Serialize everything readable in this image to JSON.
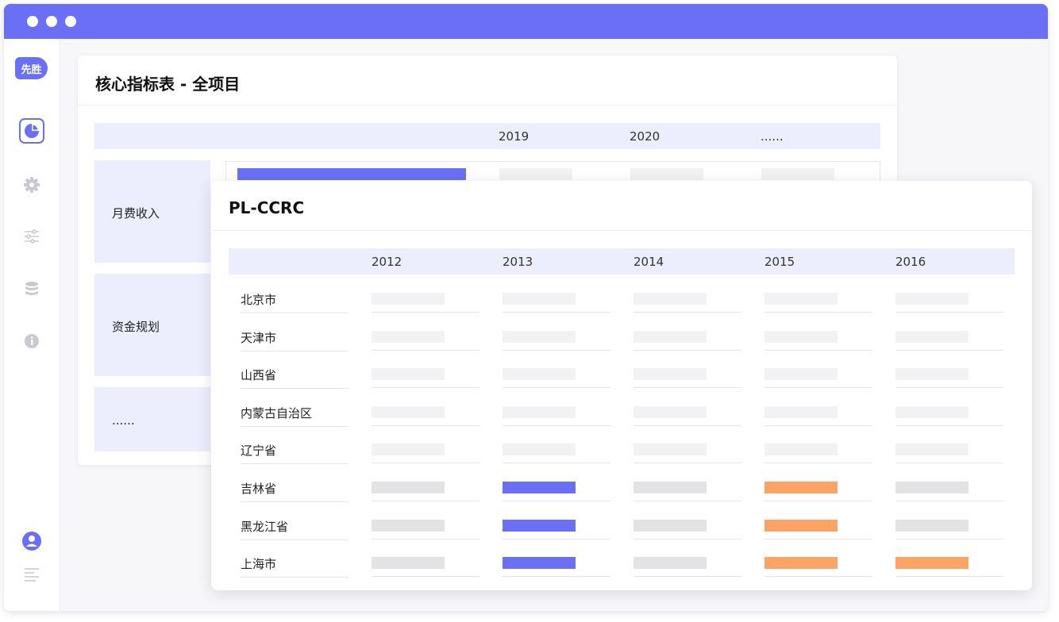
{
  "window": {
    "accent": "#6b6ff6"
  },
  "sidebar": {
    "logo_text": "先胜",
    "icons": [
      "pie-chart-icon",
      "gear-icon",
      "sliders-icon",
      "database-icon",
      "info-icon",
      "user-icon",
      "list-icon"
    ]
  },
  "back_card": {
    "title": "核心指标表 - 全项目",
    "years": [
      "2019",
      "2020",
      "......"
    ],
    "rows": [
      {
        "label": "月费收入"
      },
      {
        "label": "资金规划"
      },
      {
        "label": "......"
      }
    ]
  },
  "front_card": {
    "title": "PL-CCRC",
    "years": [
      "2012",
      "2013",
      "2014",
      "2015",
      "2016"
    ],
    "rows": [
      {
        "label": "北京市",
        "cells": [
          "light",
          "light",
          "light",
          "light",
          "light"
        ]
      },
      {
        "label": "天津市",
        "cells": [
          "light",
          "light",
          "light",
          "light",
          "light"
        ]
      },
      {
        "label": "山西省",
        "cells": [
          "light",
          "light",
          "light",
          "light",
          "light"
        ]
      },
      {
        "label": "内蒙古自治区",
        "cells": [
          "light",
          "light",
          "light",
          "light",
          "light"
        ]
      },
      {
        "label": "辽宁省",
        "cells": [
          "light",
          "light",
          "light",
          "light",
          "light"
        ]
      },
      {
        "label": "吉林省",
        "cells": [
          "gray",
          "blue",
          "gray",
          "orange",
          "gray"
        ]
      },
      {
        "label": "黑龙江省",
        "cells": [
          "gray",
          "blue",
          "gray",
          "orange",
          "gray"
        ]
      },
      {
        "label": "上海市",
        "cells": [
          "gray",
          "blue",
          "gray",
          "orange",
          "orange"
        ]
      }
    ]
  },
  "colors": {
    "blue": "#6b6ff6",
    "orange": "#fca466",
    "gray": "#e3e3e6",
    "light": "#f2f2f4",
    "header": "#ecedfd"
  }
}
